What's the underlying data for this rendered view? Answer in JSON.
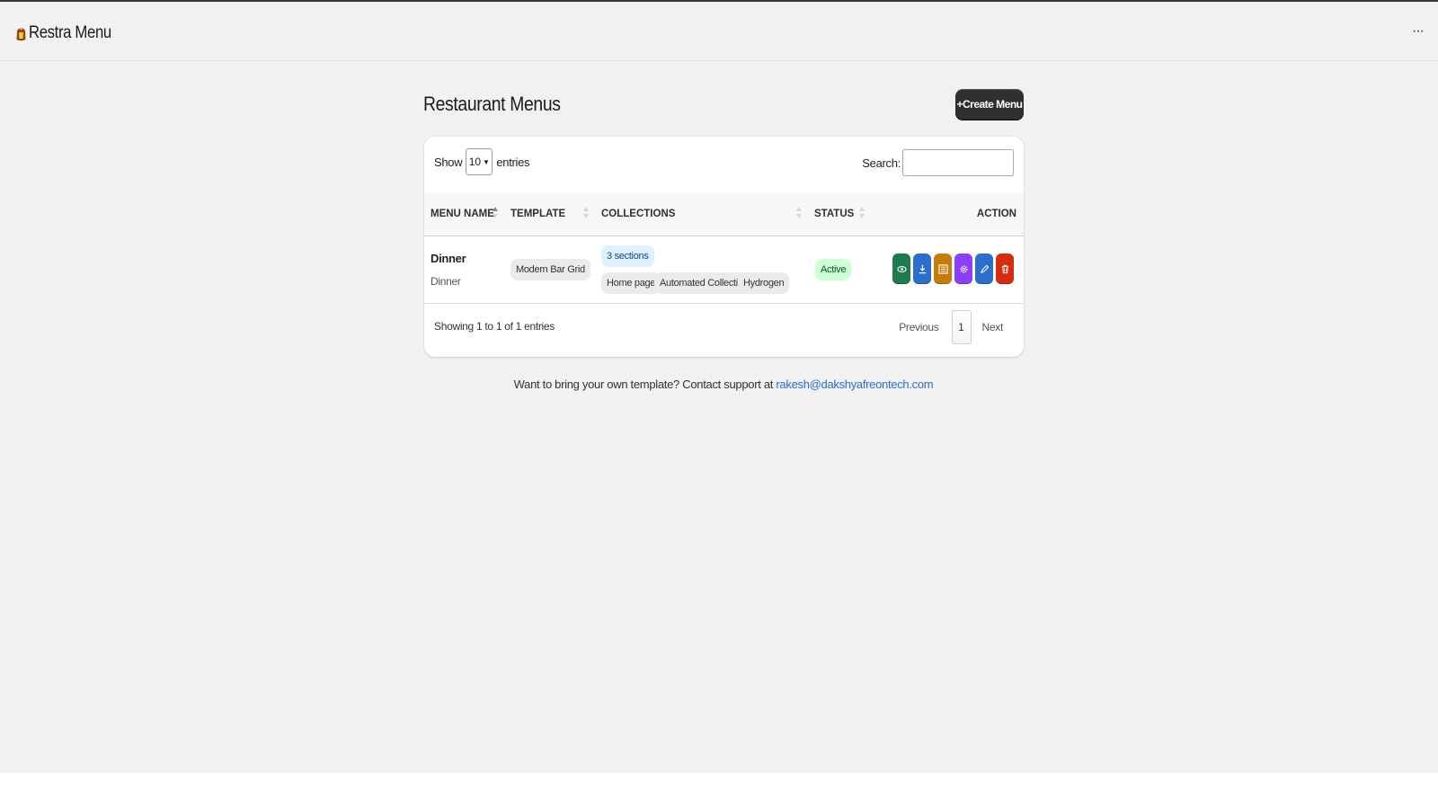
{
  "app": {
    "title": "Restra Menu",
    "more_label": "···"
  },
  "page": {
    "title": "Restaurant Menus",
    "create_button": "+Create Menu"
  },
  "table_controls": {
    "show_label": "Show",
    "entries_value": "10",
    "entries_label": "entries",
    "search_label": "Search:",
    "search_value": ""
  },
  "columns": [
    "MENU NAME",
    "TEMPLATE",
    "COLLECTIONS",
    "STATUS",
    "ACTION"
  ],
  "rows": [
    {
      "name": "Dinner",
      "subtitle": "Dinner",
      "template": "Modern Bar Grid",
      "sections": "3 sections",
      "collections": [
        "Home page",
        "Automated Collection",
        "Hydrogen"
      ],
      "status": "Active",
      "actions": [
        {
          "icon": "eye-icon",
          "color": "#1e7a4f"
        },
        {
          "icon": "download-icon",
          "color": "#2c6ecb"
        },
        {
          "icon": "qr-code-icon",
          "color": "#c77c0a"
        },
        {
          "icon": "gear-icon",
          "color": "#8a3ffc"
        },
        {
          "icon": "pencil-icon",
          "color": "#2c6ecb"
        },
        {
          "icon": "trash-icon",
          "color": "#d72c0d"
        }
      ]
    }
  ],
  "footer": {
    "info": "Showing 1 to 1 of 1 entries",
    "previous": "Previous",
    "page": "1",
    "next": "Next"
  },
  "support": {
    "text": "Want to bring your own template? Contact support at ",
    "email": "rakesh@dakshyafreontech.com"
  }
}
